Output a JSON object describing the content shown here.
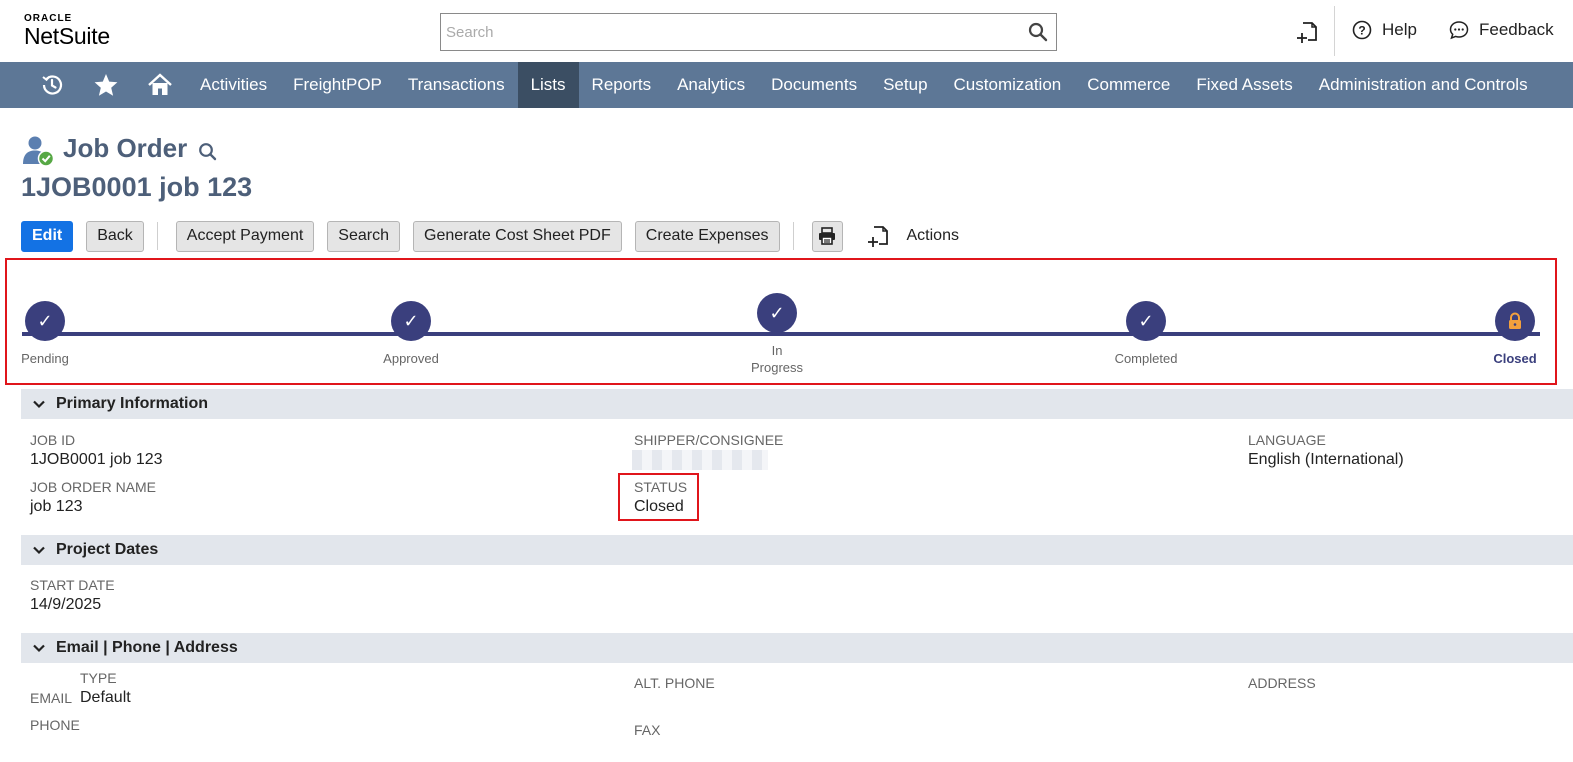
{
  "header": {
    "logo_oracle": "ORACLE",
    "logo_netsuite": "NetSuite",
    "search_placeholder": "Search",
    "help": "Help",
    "feedback": "Feedback"
  },
  "nav": {
    "items": [
      "Activities",
      "FreightPOP",
      "Transactions",
      "Lists",
      "Reports",
      "Analytics",
      "Documents",
      "Setup",
      "Customization",
      "Commerce",
      "Fixed Assets",
      "Administration and Controls"
    ],
    "active": "Lists"
  },
  "page": {
    "record_type": "Job Order",
    "title": "1JOB0001 job 123"
  },
  "buttons": {
    "edit": "Edit",
    "back": "Back",
    "accept_payment": "Accept Payment",
    "search": "Search",
    "generate_pdf": "Generate Cost Sheet PDF",
    "create_expenses": "Create Expenses",
    "actions": "Actions"
  },
  "progress": {
    "steps": [
      {
        "label": "Pending",
        "state": "done"
      },
      {
        "label": "Approved",
        "state": "done"
      },
      {
        "label_line1": "In",
        "label_line2": "Progress",
        "state": "done"
      },
      {
        "label": "Completed",
        "state": "done"
      },
      {
        "label": "Closed",
        "state": "current-locked"
      }
    ],
    "check_glyph": "✓",
    "lock_icon": "lock-icon"
  },
  "sections": {
    "primary": "Primary Information",
    "dates": "Project Dates",
    "contact": "Email | Phone | Address"
  },
  "fields": {
    "job_id_label": "JOB ID",
    "job_id_value": "1JOB0001 job 123",
    "job_order_name_label": "JOB ORDER NAME",
    "job_order_name_value": "job 123",
    "shipper_label": "SHIPPER/CONSIGNEE",
    "status_label": "STATUS",
    "status_value": "Closed",
    "language_label": "LANGUAGE",
    "language_value": "English (International)",
    "start_date_label": "START DATE",
    "start_date_value": "14/9/2025",
    "type_label": "TYPE",
    "email_label": "EMAIL",
    "type_value": "Default",
    "phone_label": "PHONE",
    "alt_phone_label": "ALT. PHONE",
    "fax_label": "FAX",
    "address_label": "ADDRESS"
  },
  "colors": {
    "nav_bg": "#5d7796",
    "nav_active": "#3b4e63",
    "primary_button": "#1372e4",
    "progress": "#3a3f7d",
    "lock": "#f2a03d",
    "highlight": "#e0151b"
  }
}
